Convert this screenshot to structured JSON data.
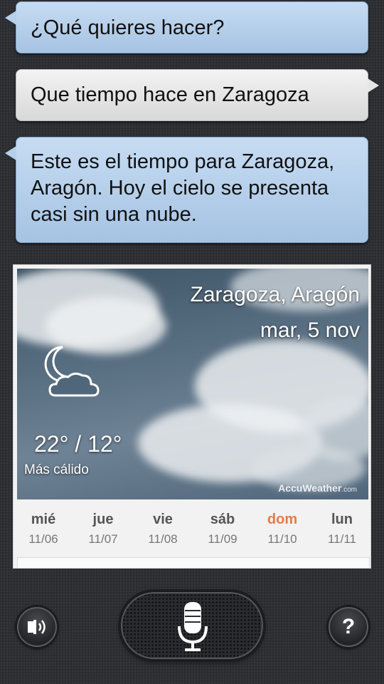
{
  "conversation": {
    "prompt": "¿Qué quieres hacer?",
    "user_query": "Que tiempo hace en Zaragoza",
    "response": "Este es el tiempo para Zaragoza, Aragón. Hoy el cielo se presenta casi sin una nube."
  },
  "weather": {
    "location": "Zaragoza, Aragón",
    "date": "mar, 5 nov",
    "temperature": "22° / 12°",
    "condition": "Más cálido",
    "provider": "AccuWeather",
    "provider_suffix": ".com",
    "condition_icon": "moon-cloud-icon",
    "forecast": [
      {
        "day": "mié",
        "date": "11/06"
      },
      {
        "day": "jue",
        "date": "11/07"
      },
      {
        "day": "vie",
        "date": "11/08"
      },
      {
        "day": "sáb",
        "date": "11/09"
      },
      {
        "day": "dom",
        "date": "11/10"
      },
      {
        "day": "lun",
        "date": "11/11"
      }
    ],
    "highlight_color": "#e87a45"
  },
  "controls": {
    "speaker_icon": "speaker-icon",
    "mic_icon": "microphone-icon",
    "help_label": "?"
  },
  "colors": {
    "assistant_bubble": "#b6d0ec",
    "user_bubble": "#e6e6e6",
    "background": "#2b2d30"
  }
}
